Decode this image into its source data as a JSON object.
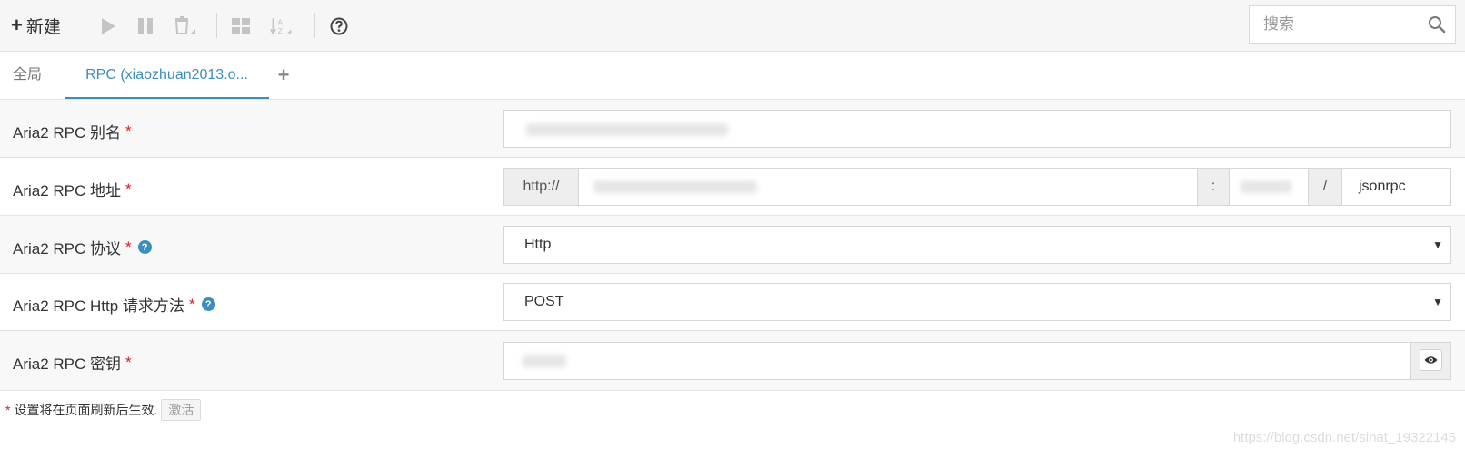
{
  "toolbar": {
    "new_label": "新建",
    "search_placeholder": "搜索",
    "icons": [
      "plus-icon",
      "play-icon",
      "pause-icon",
      "trash-icon",
      "grid-icon",
      "sort-az-icon",
      "help-circle-icon",
      "search-icon"
    ]
  },
  "tabs": {
    "global": "全局",
    "rpc": "RPC (xiaozhuan2013.o...",
    "add": "+"
  },
  "settings": {
    "alias": {
      "label": "Aria2 RPC 别名",
      "required": "*"
    },
    "address": {
      "label": "Aria2 RPC 地址",
      "required": "*",
      "protocol_prefix": "http://",
      "port_separator": ":",
      "path_separator": "/",
      "path": "jsonrpc"
    },
    "protocol": {
      "label": "Aria2 RPC 协议",
      "required": "*",
      "help": "?",
      "value": "Http"
    },
    "method": {
      "label": "Aria2 RPC Http 请求方法",
      "required": "*",
      "help": "?",
      "value": "POST"
    },
    "secret": {
      "label": "Aria2 RPC 密钥",
      "required": "*"
    }
  },
  "footer": {
    "star": "*",
    "note": "设置将在页面刷新后生效.",
    "activate": "激活"
  },
  "watermark": "https://blog.csdn.net/sinat_19322145",
  "colors": {
    "accent": "#3c8dbc",
    "required": "#dd1a1a"
  }
}
